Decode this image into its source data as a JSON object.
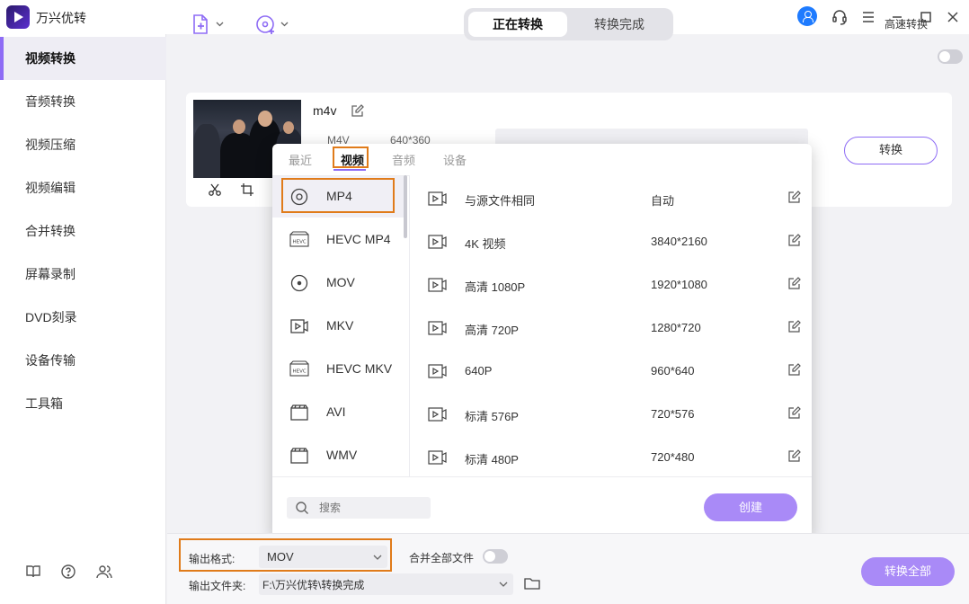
{
  "app": {
    "title": "万兴优转"
  },
  "sidebar": {
    "items": [
      {
        "label": "视频转换",
        "active": true
      },
      {
        "label": "音频转换"
      },
      {
        "label": "视频压缩"
      },
      {
        "label": "视频编辑"
      },
      {
        "label": "合并转换"
      },
      {
        "label": "屏幕录制"
      },
      {
        "label": "DVD刻录"
      },
      {
        "label": "设备传输"
      },
      {
        "label": "工具箱"
      }
    ],
    "bottom_icons": [
      "book-icon",
      "help-icon",
      "users-icon"
    ]
  },
  "toolbar": {
    "tabs": [
      "正在转换",
      "转换完成"
    ],
    "active_tab": "正在转换",
    "speed_label": "高速转换",
    "speed_enabled": false
  },
  "file": {
    "name": "m4v",
    "format": "M4V",
    "resolution": "640*360",
    "convert_label": "转换"
  },
  "popup": {
    "tabs": [
      "最近",
      "视频",
      "音频",
      "设备"
    ],
    "active_tab": "视频",
    "formats": [
      {
        "label": "MP4",
        "icon": "disc-icon"
      },
      {
        "label": "HEVC MP4",
        "icon": "hevc-icon"
      },
      {
        "label": "MOV",
        "icon": "disc-icon"
      },
      {
        "label": "MKV",
        "icon": "video-file-icon"
      },
      {
        "label": "HEVC MKV",
        "icon": "hevc-icon"
      },
      {
        "label": "AVI",
        "icon": "clapper-icon"
      },
      {
        "label": "WMV",
        "icon": "clapper-icon"
      }
    ],
    "selected_format": "MP4",
    "presets": [
      {
        "name": "与源文件相同",
        "res": "自动"
      },
      {
        "name": "4K 视频",
        "res": "3840*2160"
      },
      {
        "name": "高清 1080P",
        "res": "1920*1080"
      },
      {
        "name": "高清 720P",
        "res": "1280*720"
      },
      {
        "name": "640P",
        "res": "960*640"
      },
      {
        "name": "标清 576P",
        "res": "720*576"
      },
      {
        "name": "标清 480P",
        "res": "720*480"
      }
    ],
    "search_placeholder": "搜索",
    "create_label": "创建"
  },
  "bottom": {
    "output_format_label": "输出格式:",
    "output_format_value": "MOV",
    "merge_label": "合并全部文件",
    "merge_enabled": false,
    "output_folder_label": "输出文件夹:",
    "output_folder_value": "F:\\万兴优转\\转换完成",
    "convert_all_label": "转换全部"
  },
  "colors": {
    "accent": "#8e6cf5",
    "highlight": "#e07b1a"
  }
}
